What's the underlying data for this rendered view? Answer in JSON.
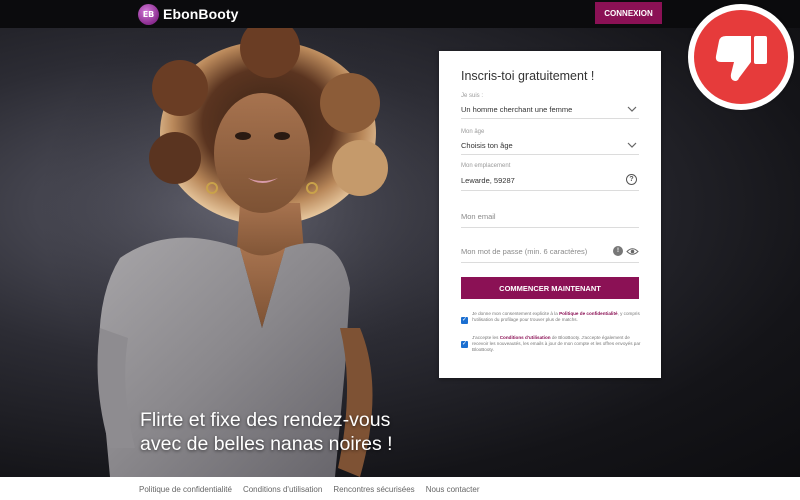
{
  "header": {
    "logo_text": "EbonBooty",
    "logo_mark": "EB",
    "login_label": "CONNEXION"
  },
  "hero": {
    "headline_line1": "Flirte et fixe des rendez-vous",
    "headline_line2": "avec de belles nanas noires !"
  },
  "form": {
    "title": "Inscris-toi gratuitement !",
    "fields": [
      {
        "label": "Je suis :",
        "value": "Un homme cherchant une femme",
        "icon": "chevron-down-icon"
      },
      {
        "label": "Mon âge",
        "value": "Choisis ton âge",
        "icon": "chevron-down-icon"
      },
      {
        "label": "Mon emplacement",
        "value": "Lewarde, 59287",
        "icon": "help-icon"
      },
      {
        "placeholder": "Mon email"
      },
      {
        "placeholder": "Mon mot de passe (min. 6 caractères)",
        "icon": "eye-icon"
      }
    ],
    "cta_label": "COMMENCER MAINTENANT",
    "consent1_a": "Je donne mon consentement explicite à la",
    "consent1_link": "Politique de confidentialité",
    "consent1_b": ", y compris l'utilisation du profilage pour trouver plus de matchs.",
    "consent2_a": "J'accepte les",
    "consent2_link": "Conditions d'utilisation",
    "consent2_b": "de BlooBooty. J'accepte également de recevoir les nouveautés, les emails à jour de mon compte et les offres envoyés par BlooBooty."
  },
  "footer": {
    "links": [
      "Politique de confidentialité",
      "Conditions d'utilisation",
      "Rencontres sécurisées",
      "Nous contacter"
    ]
  },
  "colors": {
    "brand": "#8b1155",
    "badge": "#e63b3b",
    "checkbox": "#1b6fd1"
  },
  "badge": {
    "icon": "thumbs-down-icon"
  }
}
